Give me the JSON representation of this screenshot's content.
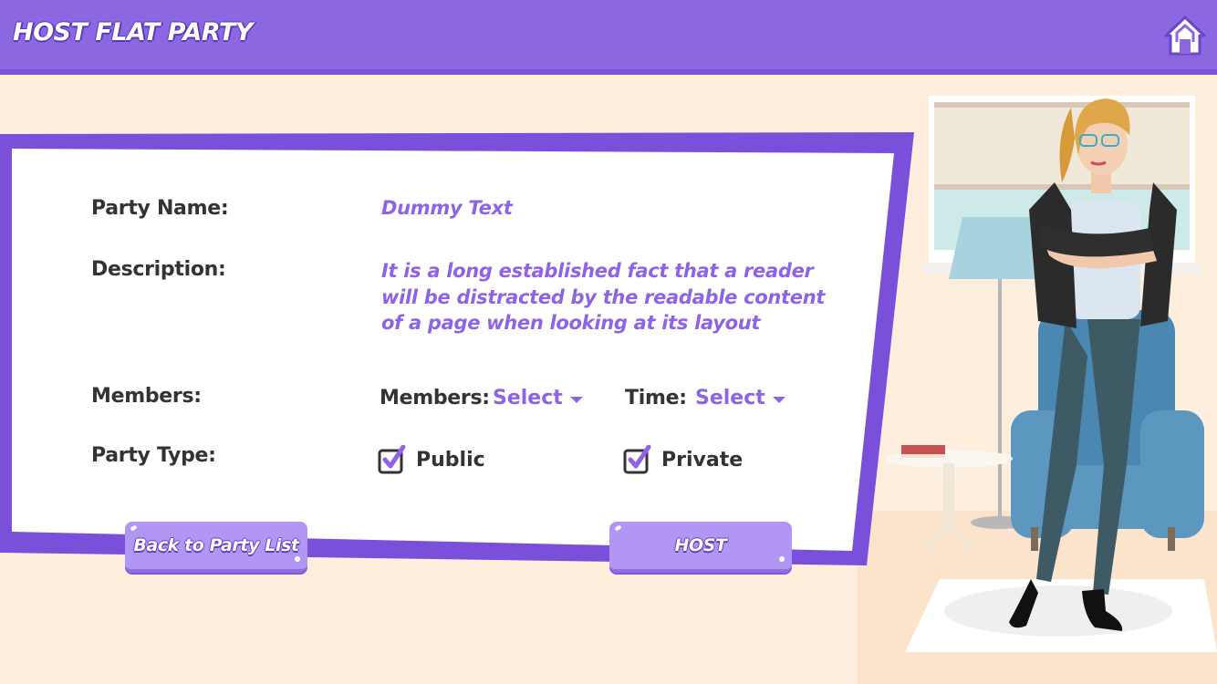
{
  "header": {
    "title": "HOST FLAT PARTY"
  },
  "form": {
    "party_name_label": "Party Name:",
    "party_name_value": "Dummy Text",
    "description_label": "Description:",
    "description_value": "It is a long established fact that a reader will be distracted by the readable content of a page when looking at its layout",
    "members_label": "Members:",
    "members_select_label": "Members:",
    "members_select_value": "Select",
    "time_select_label": "Time:",
    "time_select_value": "Select",
    "party_type_label": "Party Type:",
    "public_label": "Public",
    "public_checked": true,
    "private_label": "Private",
    "private_checked": true
  },
  "buttons": {
    "back_label": "Back to Party List",
    "host_label": "HOST"
  },
  "icons": {
    "home": "home-icon",
    "checkbox": "checkbox-checked-icon",
    "caret": "caret-down-icon"
  },
  "colors": {
    "header": "#8b67e2",
    "accent": "#8e63e6",
    "card_border": "#7a4fd9",
    "button": "#b196f3"
  }
}
